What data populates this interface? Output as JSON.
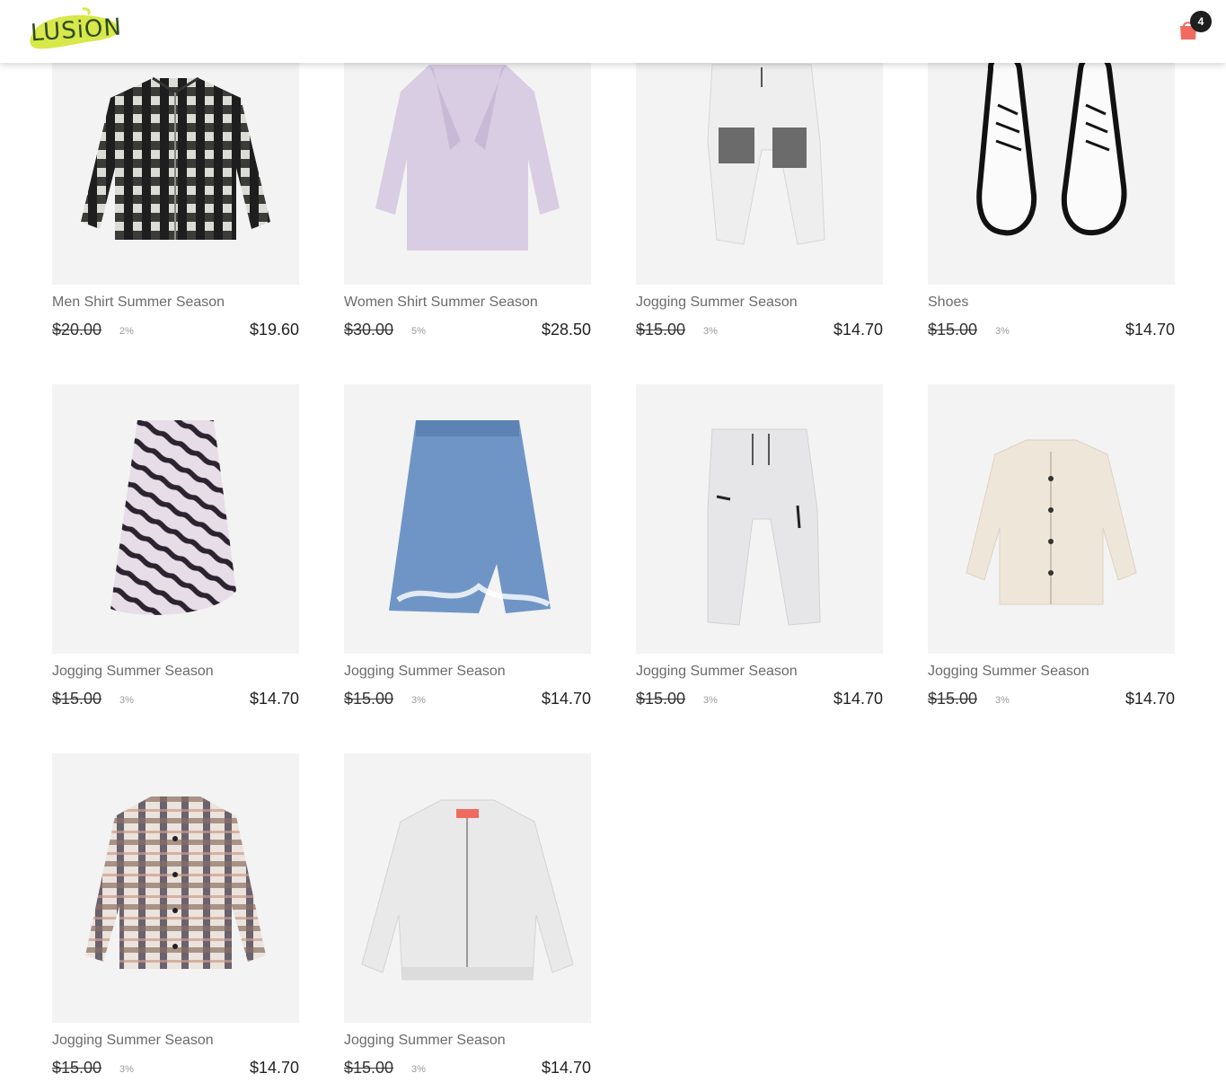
{
  "header": {
    "logo_text": "LUSiON",
    "cart_count": "4",
    "cart_color": "#f06a5f",
    "logo_color": "#d7e84a"
  },
  "products": [
    {
      "name": "Men Shirt Summer Season",
      "old_price": "$20.00",
      "discount": "2%",
      "price": "$19.60",
      "image": "plaid-shirt-black"
    },
    {
      "name": "Women Shirt Summer Season",
      "old_price": "$30.00",
      "discount": "5%",
      "price": "$28.50",
      "image": "lilac-coat"
    },
    {
      "name": "Jogging Summer Season",
      "old_price": "$15.00",
      "discount": "3%",
      "price": "$14.70",
      "image": "cargo-joggers"
    },
    {
      "name": "Shoes",
      "old_price": "$15.00",
      "discount": "3%",
      "price": "$14.70",
      "image": "white-shoes"
    },
    {
      "name": "Jogging Summer Season",
      "old_price": "$15.00",
      "discount": "3%",
      "price": "$14.70",
      "image": "zebra-skirt"
    },
    {
      "name": "Jogging Summer Season",
      "old_price": "$15.00",
      "discount": "3%",
      "price": "$14.70",
      "image": "denim-skirt"
    },
    {
      "name": "Jogging Summer Season",
      "old_price": "$15.00",
      "discount": "3%",
      "price": "$14.70",
      "image": "grey-joggers"
    },
    {
      "name": "Jogging Summer Season",
      "old_price": "$15.00",
      "discount": "3%",
      "price": "$14.70",
      "image": "cream-overshirt"
    },
    {
      "name": "Jogging Summer Season",
      "old_price": "$15.00",
      "discount": "3%",
      "price": "$14.70",
      "image": "plaid-overshirt"
    },
    {
      "name": "Jogging Summer Season",
      "old_price": "$15.00",
      "discount": "3%",
      "price": "$14.70",
      "image": "bomber-jacket"
    }
  ]
}
